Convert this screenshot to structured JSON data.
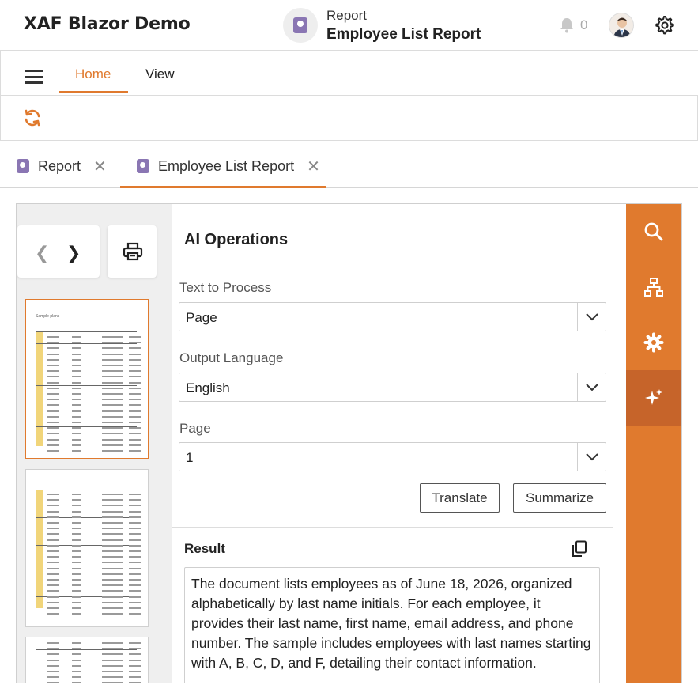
{
  "header": {
    "app_title": "XAF Blazor Demo",
    "view_subtitle": "Report",
    "view_title": "Employee List Report",
    "notification_count": "0"
  },
  "nav": {
    "tabs": [
      {
        "label": "Home",
        "active": true
      },
      {
        "label": "View",
        "active": false
      }
    ]
  },
  "doc_tabs": [
    {
      "label": "Report",
      "active": false
    },
    {
      "label": "Employee List Report",
      "active": true
    }
  ],
  "ai_panel": {
    "title": "AI Operations",
    "fields": [
      {
        "label": "Text to Process",
        "value": "Page"
      },
      {
        "label": "Output Language",
        "value": "English"
      },
      {
        "label": "Page",
        "value": "1"
      }
    ],
    "buttons": {
      "translate": "Translate",
      "summarize": "Summarize"
    },
    "result_label": "Result",
    "result_text": "The document lists employees as of June 18, 2026, organized alphabetically by last name initials. For each employee, it provides their last name, first name, email address, and phone number. The sample includes employees with last names starting with A, B, C, D, and F, detailing their contact information."
  },
  "thumbnails": {
    "page1_title": "Sample plans"
  },
  "colors": {
    "accent": "#e07a2e",
    "accent_dark": "#c6642a",
    "report_icon": "#8a76b3",
    "group_band": "#f1d57a"
  },
  "icons": {
    "report": "report-icon",
    "bell": "bell-icon",
    "settings": "gear-icon",
    "menu": "hamburger-icon",
    "refresh": "refresh-icon",
    "print": "print-icon",
    "copy": "copy-icon",
    "rail": [
      "search-icon",
      "document-map-icon",
      "settings-icon",
      "ai-sparkle-icon"
    ]
  }
}
